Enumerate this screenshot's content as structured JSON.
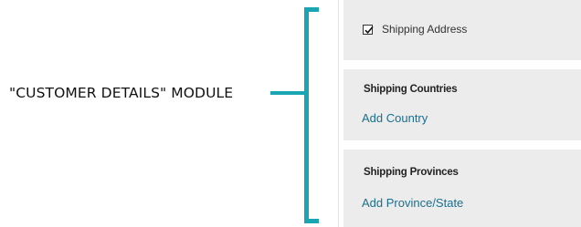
{
  "annotation": {
    "label": "\"CUSTOMER DETAILS\" MODULE",
    "accent_color": "#1aa5b3"
  },
  "settings": {
    "shipping_address": {
      "label": "Shipping Address",
      "checked": true
    },
    "shipping_countries": {
      "heading": "Shipping Countries",
      "link": "Add Country"
    },
    "shipping_provinces": {
      "heading": "Shipping Provinces",
      "link": "Add Province/State"
    }
  },
  "colors": {
    "panel_background": "#ececec",
    "link": "#1a6f8f"
  }
}
